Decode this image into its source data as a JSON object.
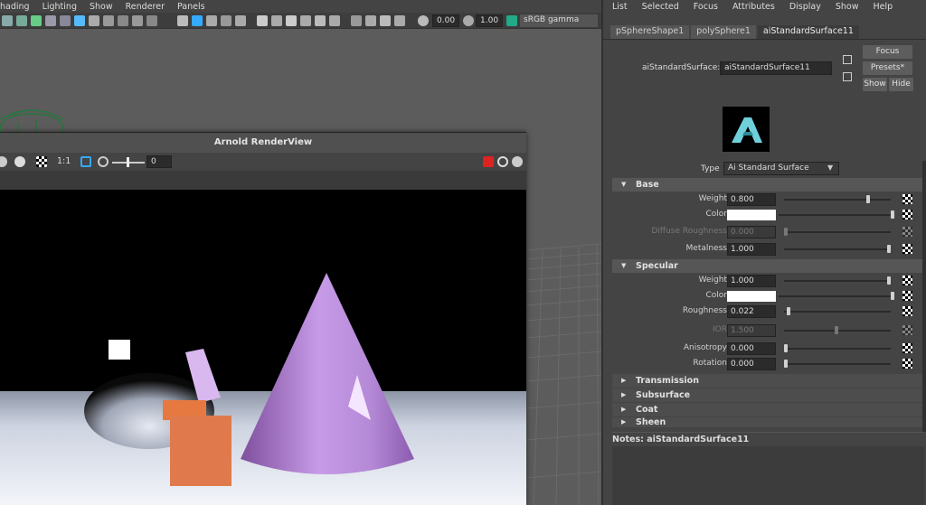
{
  "viewport": {
    "menu": [
      "hading",
      "Lighting",
      "Show",
      "Renderer",
      "Panels"
    ],
    "field_a": "0.00",
    "field_b": "1.00",
    "gamma": "sRGB gamma"
  },
  "renderview": {
    "title": "Arnold RenderView",
    "ratio": "1:1",
    "exposure": "0"
  },
  "attr": {
    "menu": [
      "List",
      "Selected",
      "Focus",
      "Attributes",
      "Display",
      "Show",
      "Help"
    ],
    "tabs": [
      "pSphereShape1",
      "polySphere1",
      "aiStandardSurface11"
    ],
    "shader_label": "aiStandardSurface:",
    "shader_name": "aiStandardSurface11",
    "focus": "Focus",
    "presets": "Presets*",
    "show": "Show",
    "hide": "Hide",
    "type_label": "Type",
    "type_value": "Ai Standard Surface",
    "base": {
      "title": "Base",
      "weight_label": "Weight",
      "weight": "0.800",
      "weight_frac": 0.8,
      "color_label": "Color",
      "diffuse_label": "Diffuse Roughness",
      "diffuse": "0.000",
      "diffuse_frac": 0.0,
      "metalness_label": "Metalness",
      "metalness": "1.000",
      "metalness_frac": 1.0
    },
    "specular": {
      "title": "Specular",
      "weight_label": "Weight",
      "weight": "1.000",
      "weight_frac": 1.0,
      "color_label": "Color",
      "roughness_label": "Roughness",
      "roughness": "0.022",
      "roughness_frac": 0.022,
      "ior_label": "IOR",
      "ior": "1.500",
      "aniso_label": "Anisotropy",
      "aniso": "0.000",
      "aniso_frac": 0.0,
      "rotation_label": "Rotation",
      "rotation": "0.000",
      "rotation_frac": 0.0
    },
    "collapsed": [
      "Transmission",
      "Subsurface",
      "Coat",
      "Sheen"
    ],
    "notes_label": "Notes:",
    "notes_name": "aiStandardSurface11"
  }
}
